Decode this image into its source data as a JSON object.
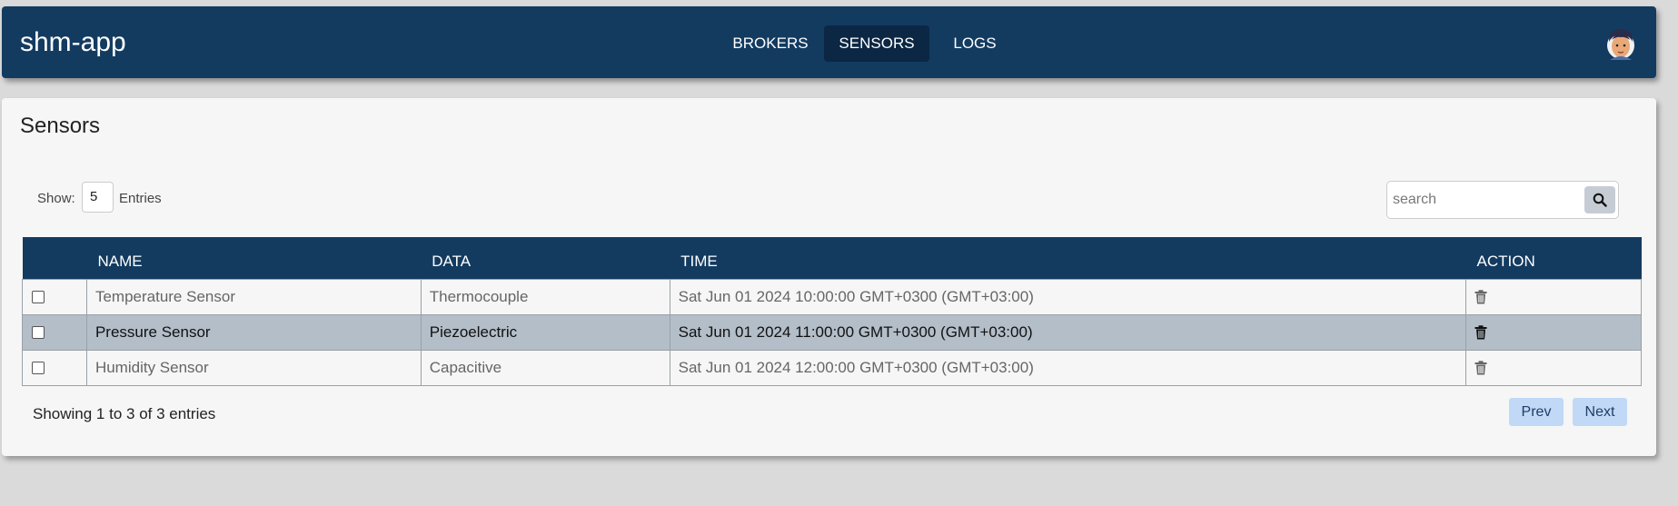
{
  "app": {
    "brand": "shm-app"
  },
  "nav": {
    "items": [
      {
        "label": "BROKERS"
      },
      {
        "label": "SENSORS"
      },
      {
        "label": "LOGS"
      }
    ],
    "active": "SENSORS",
    "avatar_icon": "user-avatar-icon"
  },
  "page": {
    "title": "Sensors"
  },
  "controls": {
    "show_label": "Show:",
    "page_size": "5",
    "entries_label": "Entries",
    "search_placeholder": "search",
    "search_icon": "magnifier-icon"
  },
  "table": {
    "headers": [
      "",
      "NAME",
      "DATA",
      "TIME",
      "ACTION"
    ],
    "rows": [
      {
        "name": "Temperature Sensor",
        "data": "Thermocouple",
        "time": "Sat Jun 01 2024 10:00:00 GMT+0300 (GMT+03:00)",
        "checked": false,
        "highlighted": false
      },
      {
        "name": "Pressure Sensor",
        "data": "Piezoelectric",
        "time": "Sat Jun 01 2024 11:00:00 GMT+0300 (GMT+03:00)",
        "checked": false,
        "highlighted": true
      },
      {
        "name": "Humidity Sensor",
        "data": "Capacitive",
        "time": "Sat Jun 01 2024 12:00:00 GMT+0300 (GMT+03:00)",
        "checked": false,
        "highlighted": false
      }
    ],
    "action_icon": "trash-icon"
  },
  "footer": {
    "summary": "Showing 1 to 3 of 3 entries",
    "prev_label": "Prev",
    "next_label": "Next"
  },
  "colors": {
    "navbar": "#133b60",
    "active_tab": "#0b2744",
    "row_highlight": "#b3bec8",
    "pager_button": "#c1d9f7"
  }
}
